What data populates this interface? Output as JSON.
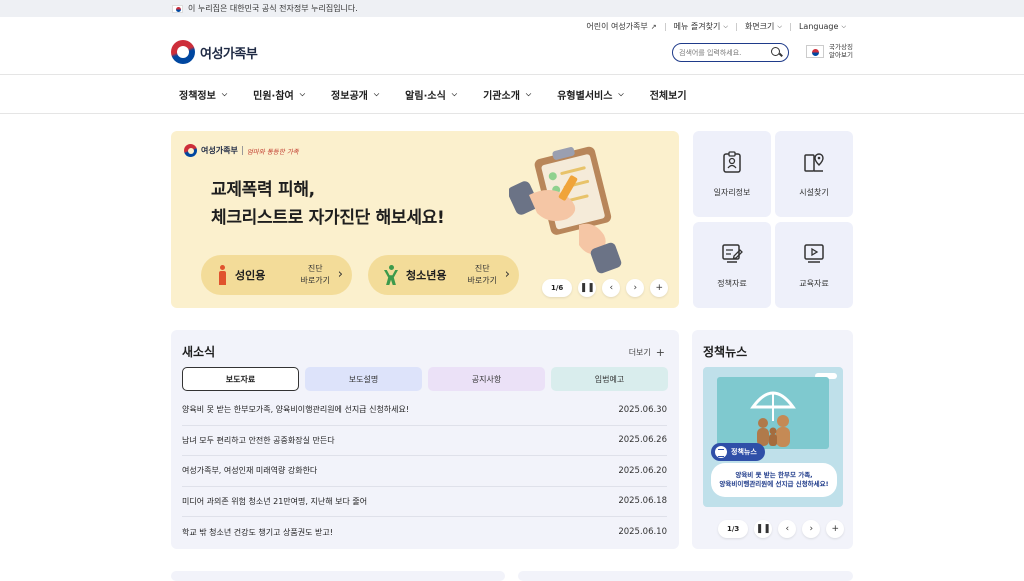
{
  "gov_banner": {
    "text": "이 누리집은 대한민국 공식 전자정부 누리집입니다."
  },
  "utility": {
    "kids": "어린이 여성가족부",
    "menu": "메뉴 즐겨찾기",
    "zoom": "화면크기",
    "language": "Language"
  },
  "header": {
    "logo_text": "여성가족부",
    "search_placeholder": "검색어를 입력하세요.",
    "national_symbol": "국가상징 알아보기"
  },
  "nav": {
    "items": [
      {
        "label": "정책정보"
      },
      {
        "label": "민원·참여"
      },
      {
        "label": "정보공개"
      },
      {
        "label": "알림·소식"
      },
      {
        "label": "기관소개"
      },
      {
        "label": "유형별서비스"
      },
      {
        "label": "전체보기"
      }
    ]
  },
  "hero": {
    "logo": "여성가족부",
    "slogan": "엄마와 동등한 가족",
    "title_line1": "교제폭력 피해,",
    "title_line2": "체크리스트로 자가진단 해보세요!",
    "buttons": [
      {
        "label": "성인용",
        "go_line1": "진단",
        "go_line2": "바로가기"
      },
      {
        "label": "청소년용",
        "go_line1": "진단",
        "go_line2": "바로가기"
      }
    ],
    "counter": "1/6"
  },
  "quick_links": [
    {
      "label": "일자리정보",
      "icon": "id-card-icon"
    },
    {
      "label": "시설찾기",
      "icon": "map-pin-icon"
    },
    {
      "label": "정책자료",
      "icon": "document-edit-icon"
    },
    {
      "label": "교육자료",
      "icon": "video-play-icon"
    }
  ],
  "news": {
    "title": "새소식",
    "more": "더보기",
    "tabs": [
      {
        "label": "보도자료"
      },
      {
        "label": "보도설명"
      },
      {
        "label": "공지사항"
      },
      {
        "label": "입법예고"
      }
    ],
    "items": [
      {
        "title": "양육비 못 받는 한부모가족, 양육비이행관리원에 선지급 신청하세요!",
        "date": "2025.06.30"
      },
      {
        "title": "남녀 모두 편리하고 안전한 공중화장실 만든다",
        "date": "2025.06.26"
      },
      {
        "title": "여성가족부, 여성인재 미래역량 강화한다",
        "date": "2025.06.20"
      },
      {
        "title": "미디어 과의존 위험 청소년 21만여명, 지난해 보다 줄어",
        "date": "2025.06.18"
      },
      {
        "title": "학교 밖 청소년 건강도 챙기고 상품권도 받고!",
        "date": "2025.06.10"
      }
    ]
  },
  "policy_news": {
    "title": "정책뉴스",
    "badge": "정책뉴스",
    "card_line1": "양육비 못 받는 한부모 가족,",
    "card_line2": "양육비이행관리원에 선지급 신청하세요!",
    "counter": "1/3"
  },
  "colors": {
    "hero_bg": "#fbf0cd",
    "pill_bg": "#f3dc99",
    "panel_bg": "#f2f3fa",
    "accent_blue": "#1f3b8a"
  }
}
